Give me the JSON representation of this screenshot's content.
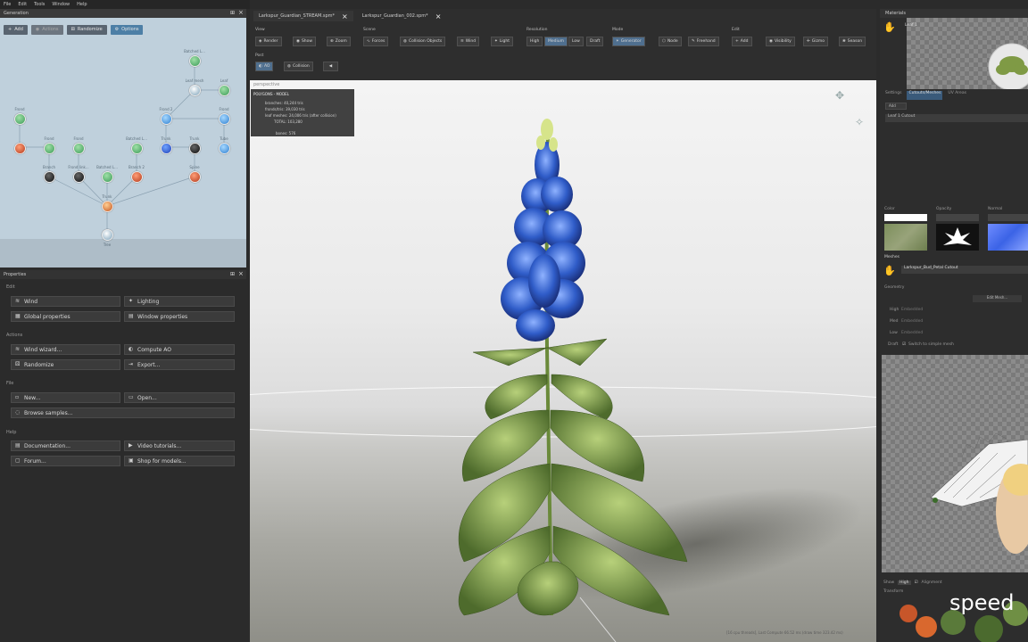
{
  "menu": [
    "File",
    "Edit",
    "Tools",
    "Window",
    "Help"
  ],
  "generation": {
    "title": "Generation",
    "tools": [
      {
        "label": "Add",
        "icon": "plus-icon"
      },
      {
        "label": "Actions",
        "icon": "actions-icon"
      },
      {
        "label": "Randomize",
        "icon": "dice-icon"
      },
      {
        "label": "Options",
        "icon": "gear-icon"
      }
    ],
    "node_labels": [
      "Batched L...",
      "Leaf mesh",
      "Leaf",
      "Frond",
      "Frond 2",
      "Frond",
      "Frond",
      "Frond",
      "Batched L...",
      "Trunk",
      "Trunk",
      "Trunk",
      "Tube",
      "Branch",
      "Frond link...",
      "Batched L...",
      "Branch 2",
      "Spine",
      "Trunk",
      "Tree"
    ]
  },
  "properties": {
    "title": "Properties",
    "sections": {
      "edit": "Edit",
      "actions": "Actions",
      "file": "File",
      "help": "Help"
    },
    "buttons": {
      "wind": "Wind",
      "lighting": "Lighting",
      "global_properties": "Global properties",
      "window_properties": "Window properties",
      "wind_wizard": "Wind wizard...",
      "compute_ao": "Compute AO",
      "randomize": "Randomize",
      "export": "Export...",
      "new": "New...",
      "open": "Open...",
      "browse_samples": "Browse samples...",
      "documentation": "Documentation...",
      "video_tutorials": "Video tutorials...",
      "forum": "Forum...",
      "shop_for_models": "Shop for models..."
    }
  },
  "tabs": [
    {
      "label": "Larkspur_Guardian_STREAM.spm*"
    },
    {
      "label": "Larkspur_Guardian_002.spm*"
    }
  ],
  "toolbar": {
    "groups": {
      "view": "View",
      "scene": "Scene",
      "resolution": "Resolution",
      "mode": "Mode",
      "edit": "Edit",
      "post": "Post"
    },
    "buttons": {
      "render": "Render",
      "show": "Show",
      "zoom": "Zoom",
      "forces": "Forces",
      "collision_objects": "Collision Objects",
      "wind": "Wind",
      "light": "Light",
      "high": "High",
      "medium": "Medium",
      "low": "Low",
      "draft": "Draft",
      "generator": "Generator",
      "node": "Node",
      "freehand": "Freehand",
      "add": "Add",
      "visibility": "Visibility",
      "gizmo": "Gizmo",
      "season": "Season",
      "ao": "AO",
      "collision": "Collision"
    }
  },
  "viewport": {
    "camera": "perspective",
    "stats": {
      "header": "POLYGONS - MODEL",
      "branches": "branches: 40,244 tris",
      "fronds": "fronds/tris: 39,030 tris",
      "leaf_meshes": "leaf meshes: 24,006 tris (after collision)",
      "total": "TOTAL: 103,280",
      "bones": "bones: 576"
    },
    "status": "[16 cpu threads], Last Compute 66.52 ms (draw time 323.42 ms)"
  },
  "materials": {
    "title": "Materials",
    "selected": "Leaf 1",
    "tabs": [
      "Settings",
      "Cutouts/Meshes",
      "UV Areas"
    ],
    "add_label": "Add",
    "cutout_name": "Leaf 1 Cutout",
    "maps": [
      "Color",
      "Opacity",
      "Normal"
    ],
    "meshes_label": "Meshes",
    "mesh_name": "Larkspur_Bud_Petal Cutout",
    "geometry_label": "Geometry",
    "edit_mesh": "Edit Mesh...",
    "lods": [
      {
        "level": "High",
        "value": "Embedded"
      },
      {
        "level": "Med",
        "value": "Embedded"
      },
      {
        "level": "Low",
        "value": "Embedded"
      }
    ],
    "draft": "Draft",
    "switch_simple": "Switch to simple mesh",
    "show_label": "Show",
    "show_value": "High",
    "alignment": "Alignment",
    "transform": "Transform"
  },
  "watermark": "speed",
  "colors": {
    "accent_blue": "#4d7fa6",
    "graph_bg": "#bfd0dc",
    "panel_bg": "#2b2b2b"
  }
}
